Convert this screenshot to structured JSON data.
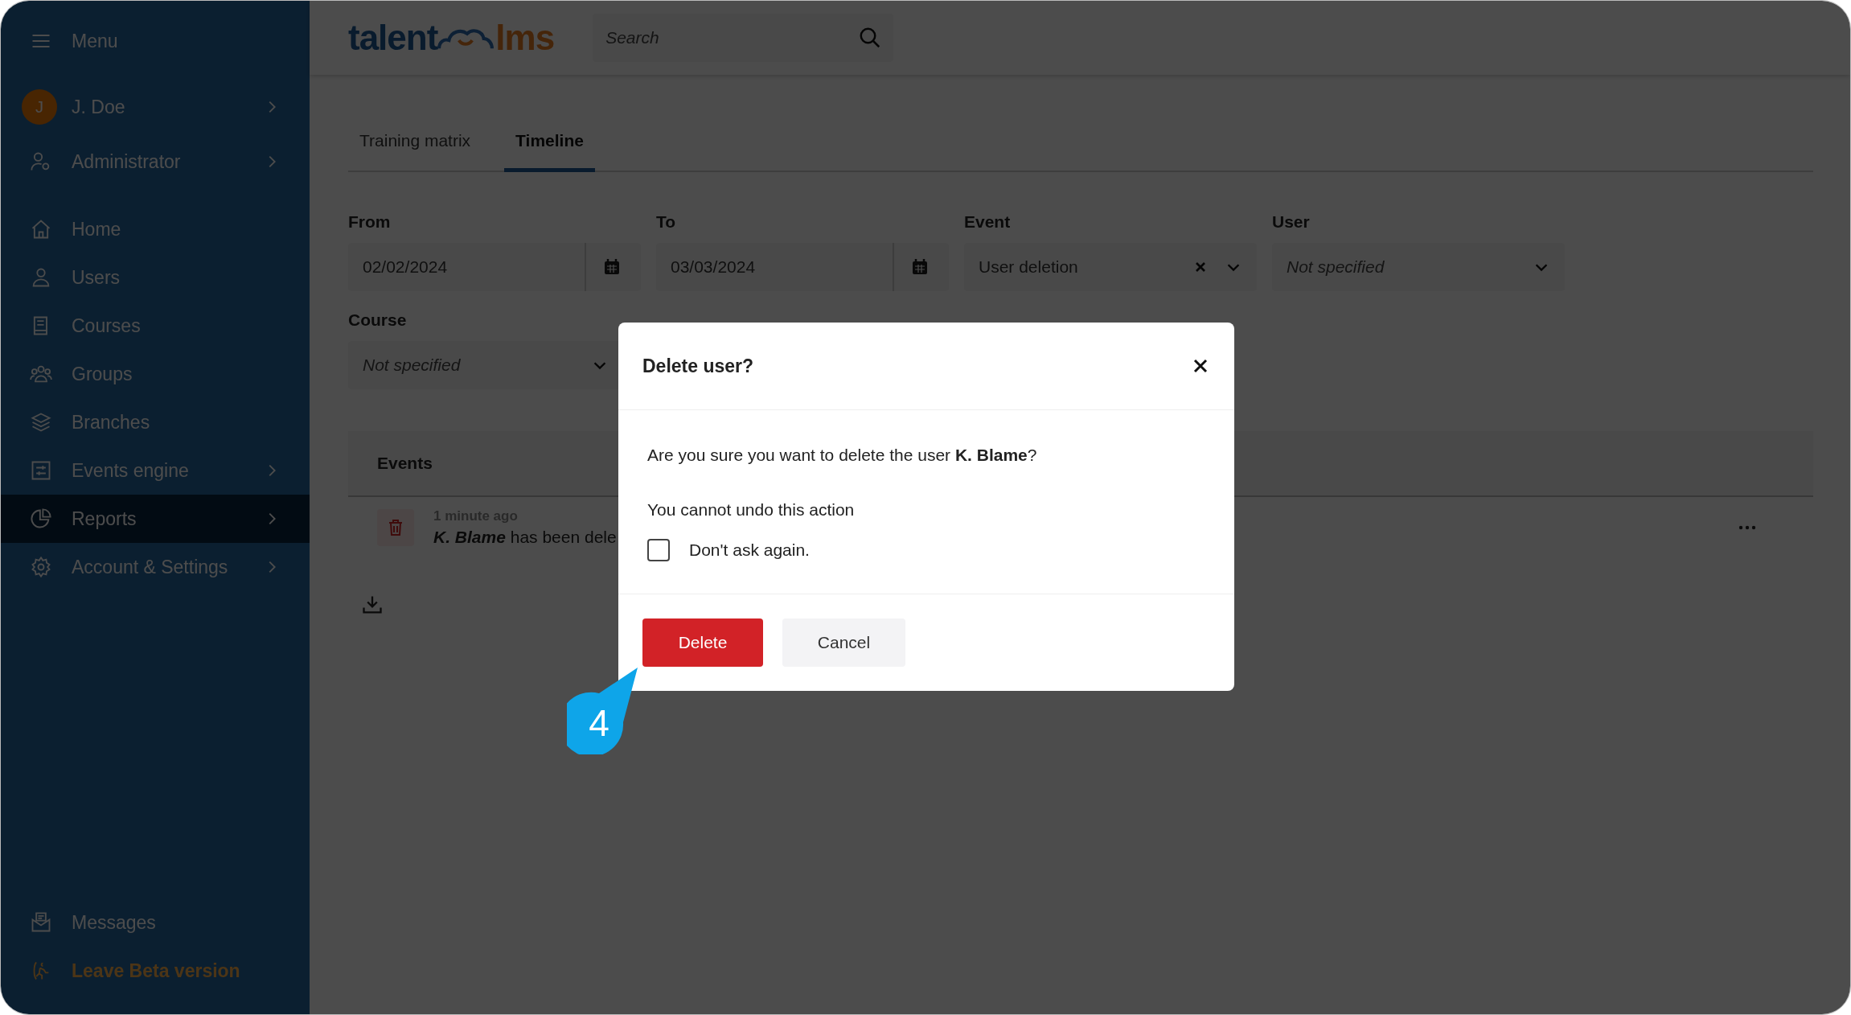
{
  "sidebar": {
    "menu_label": "Menu",
    "user": {
      "initial": "J",
      "name": "J. Doe",
      "expandable": true
    },
    "items": [
      {
        "kind": "role",
        "label": "Administrator",
        "expandable": true,
        "selected": false
      },
      {
        "kind": "home",
        "label": "Home",
        "expandable": false,
        "selected": false
      },
      {
        "kind": "users",
        "label": "Users",
        "expandable": false,
        "selected": false
      },
      {
        "kind": "courses",
        "label": "Courses",
        "expandable": false,
        "selected": false
      },
      {
        "kind": "groups",
        "label": "Groups",
        "expandable": false,
        "selected": false
      },
      {
        "kind": "branches",
        "label": "Branches",
        "expandable": false,
        "selected": false
      },
      {
        "kind": "events",
        "label": "Events engine",
        "expandable": true,
        "selected": false
      },
      {
        "kind": "reports",
        "label": "Reports",
        "expandable": true,
        "selected": true
      },
      {
        "kind": "settings",
        "label": "Account & Settings",
        "expandable": true,
        "selected": false
      }
    ],
    "bottom_items": [
      {
        "kind": "messages",
        "label": "Messages"
      },
      {
        "kind": "leave",
        "label": "Leave Beta version"
      }
    ]
  },
  "header": {
    "logo": {
      "left": "talent",
      "right": "lms"
    },
    "search": {
      "placeholder": "Search"
    }
  },
  "tabs": [
    {
      "label": "Training matrix",
      "selected": false
    },
    {
      "label": "Timeline",
      "selected": true
    }
  ],
  "filters": [
    {
      "kind": "date",
      "label": "From",
      "value": "02/02/2024"
    },
    {
      "kind": "date",
      "label": "To",
      "value": "03/03/2024"
    },
    {
      "kind": "select",
      "label": "Event",
      "value": "User deletion",
      "clearable": true
    },
    {
      "kind": "select",
      "label": "User",
      "placeholder": "Not specified",
      "clearable": false
    },
    {
      "kind": "select",
      "label": "Course",
      "placeholder": "Not specified",
      "clearable": false
    }
  ],
  "events_table": {
    "heading": "Events",
    "rows": [
      {
        "time": "1 minute ago",
        "user": "K. Blame",
        "action": "has been dele"
      }
    ]
  },
  "dialog": {
    "title": "Delete user?",
    "message": "Are you sure you want to delete the user **K. Blame**?",
    "note": "You cannot undo this action",
    "checkbox": {
      "label": "Don't ask again.",
      "checked": false
    },
    "buttons": [
      {
        "kind": "danger",
        "label": "Delete"
      },
      {
        "kind": "secondary",
        "label": "Cancel"
      }
    ]
  },
  "callout": {
    "label": "4"
  }
}
